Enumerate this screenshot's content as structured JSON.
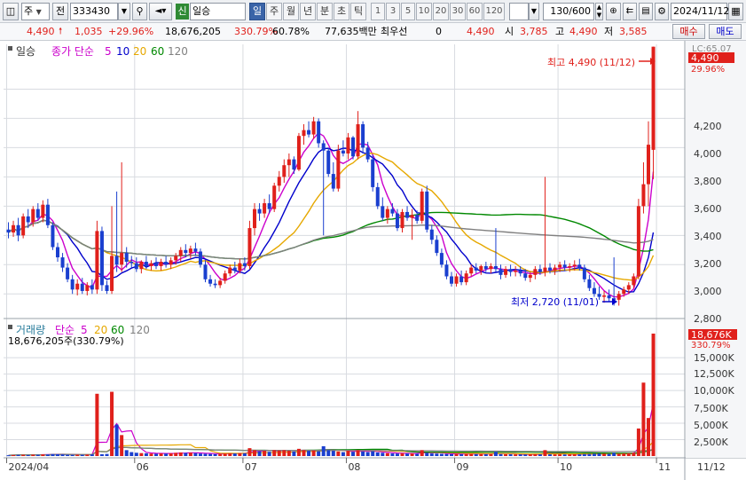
{
  "toolbar": {
    "market": "주",
    "prev_label": "전",
    "code": "333430",
    "credit_tag": "신",
    "stock_name": "일승",
    "periods": [
      "일",
      "주",
      "월",
      "년",
      "분",
      "초",
      "틱"
    ],
    "active_period": "일",
    "minute_units": [
      "1",
      "3",
      "5",
      "10",
      "20",
      "30",
      "60",
      "120"
    ],
    "count": "130/600",
    "date": "2024/11/12"
  },
  "quote": {
    "price": "4,490",
    "change": "1,035",
    "change_pct": "+29.96%",
    "volume": "18,676,205",
    "volume_ratio": "330.79%",
    "turnover": "60.78%",
    "amount": "77,635백만",
    "best_bid_label": "최우선",
    "best_bid": "0",
    "best_ask": "4,490",
    "open_label": "시",
    "open": "3,785",
    "high_label": "고",
    "high": "4,490",
    "low_label": "저",
    "low": "3,585",
    "buy_label": "매수",
    "sell_label": "매도"
  },
  "price_pane": {
    "legend_period": "일승",
    "legend_label": "종가 단순",
    "ma_periods": [
      "5",
      "10",
      "20",
      "60",
      "120"
    ],
    "ma_colors": [
      "#cc00cc",
      "#0000cc",
      "#e6a800",
      "#008800",
      "#808080"
    ],
    "axis_ticks": [
      "4,200",
      "4,000",
      "3,800",
      "3,600",
      "3,400",
      "3,200",
      "3,000",
      "2,800"
    ],
    "price_tag": "4,490",
    "price_tag_pct": "29.96%",
    "lc_label": "LC:65.07",
    "high_annotation": "최고 4,490 (11/12)",
    "low_annotation": "최저 2,720 (11/01)"
  },
  "volume_pane": {
    "legend_label": "거래량",
    "legend_ma": "단순",
    "ma_periods": [
      "5",
      "20",
      "60",
      "120"
    ],
    "info": "18,676,205주(330.79%)",
    "axis_ticks": [
      "15,000K",
      "12,500K",
      "10,000K",
      "7,500K",
      "5,000K",
      "2,500K"
    ],
    "volume_tag": "18,676K",
    "volume_tag_pct": "330.79%"
  },
  "x_axis": {
    "labels": [
      "2024/04",
      "06",
      "07",
      "08",
      "09",
      "10",
      "11"
    ],
    "current": "11/12"
  },
  "colors": {
    "up": "#e0201b",
    "down": "#1a3fcf",
    "grid": "#d8dbe0",
    "accent": "#3a64a8"
  },
  "chart_data": {
    "type": "candlestick",
    "y_range": [
      2650,
      4500
    ],
    "volume_range": [
      0,
      18676
    ],
    "months": [
      [
        "2024/04",
        0
      ],
      [
        "06",
        26
      ],
      [
        "07",
        48
      ],
      [
        "08",
        69
      ],
      [
        "09",
        91
      ],
      [
        "10",
        112
      ],
      [
        "11",
        132
      ]
    ],
    "candles": [
      {
        "o": 3240,
        "h": 3290,
        "l": 3180,
        "c": 3220
      },
      {
        "o": 3220,
        "h": 3300,
        "l": 3190,
        "c": 3270
      },
      {
        "o": 3270,
        "h": 3320,
        "l": 3160,
        "c": 3200
      },
      {
        "o": 3200,
        "h": 3350,
        "l": 3180,
        "c": 3330
      },
      {
        "o": 3330,
        "h": 3380,
        "l": 3250,
        "c": 3290
      },
      {
        "o": 3290,
        "h": 3400,
        "l": 3260,
        "c": 3380
      },
      {
        "o": 3380,
        "h": 3420,
        "l": 3300,
        "c": 3320
      },
      {
        "o": 3320,
        "h": 3440,
        "l": 3290,
        "c": 3410
      },
      {
        "o": 3410,
        "h": 3450,
        "l": 3250,
        "c": 3270
      },
      {
        "o": 3270,
        "h": 3290,
        "l": 3100,
        "c": 3120
      },
      {
        "o": 3120,
        "h": 3150,
        "l": 3020,
        "c": 3050
      },
      {
        "o": 3050,
        "h": 3080,
        "l": 2950,
        "c": 2980
      },
      {
        "o": 2980,
        "h": 3010,
        "l": 2880,
        "c": 2900
      },
      {
        "o": 2900,
        "h": 2930,
        "l": 2800,
        "c": 2830
      },
      {
        "o": 2830,
        "h": 2900,
        "l": 2790,
        "c": 2870
      },
      {
        "o": 2870,
        "h": 2910,
        "l": 2800,
        "c": 2820
      },
      {
        "o": 2820,
        "h": 2880,
        "l": 2790,
        "c": 2860
      },
      {
        "o": 2860,
        "h": 2900,
        "l": 2800,
        "c": 2830
      },
      {
        "o": 2830,
        "h": 3300,
        "l": 2800,
        "c": 3230
      },
      {
        "o": 3230,
        "h": 3260,
        "l": 2820,
        "c": 2860
      },
      {
        "o": 2860,
        "h": 2890,
        "l": 2800,
        "c": 2820
      },
      {
        "o": 2820,
        "h": 3400,
        "l": 2800,
        "c": 3060
      },
      {
        "o": 3060,
        "h": 3500,
        "l": 2950,
        "c": 3000
      },
      {
        "o": 3000,
        "h": 3700,
        "l": 2950,
        "c": 3080
      },
      {
        "o": 3080,
        "h": 3120,
        "l": 2980,
        "c": 3020
      },
      {
        "o": 3020,
        "h": 3060,
        "l": 2980,
        "c": 3010
      },
      {
        "o": 3010,
        "h": 3050,
        "l": 2950,
        "c": 2970
      },
      {
        "o": 2970,
        "h": 3030,
        "l": 2940,
        "c": 3020
      },
      {
        "o": 3020,
        "h": 3060,
        "l": 2970,
        "c": 2990
      },
      {
        "o": 2990,
        "h": 3030,
        "l": 2960,
        "c": 3010
      },
      {
        "o": 3010,
        "h": 3050,
        "l": 2970,
        "c": 2990
      },
      {
        "o": 2990,
        "h": 3040,
        "l": 2960,
        "c": 3020
      },
      {
        "o": 3020,
        "h": 3060,
        "l": 2980,
        "c": 3000
      },
      {
        "o": 3000,
        "h": 3050,
        "l": 2970,
        "c": 3030
      },
      {
        "o": 3030,
        "h": 3080,
        "l": 3000,
        "c": 3060
      },
      {
        "o": 3060,
        "h": 3120,
        "l": 3020,
        "c": 3100
      },
      {
        "o": 3100,
        "h": 3140,
        "l": 3050,
        "c": 3080
      },
      {
        "o": 3080,
        "h": 3130,
        "l": 3040,
        "c": 3110
      },
      {
        "o": 3110,
        "h": 3150,
        "l": 3060,
        "c": 3090
      },
      {
        "o": 3090,
        "h": 3110,
        "l": 2980,
        "c": 3000
      },
      {
        "o": 3000,
        "h": 3030,
        "l": 2880,
        "c": 2900
      },
      {
        "o": 2900,
        "h": 2930,
        "l": 2850,
        "c": 2870
      },
      {
        "o": 2870,
        "h": 2900,
        "l": 2840,
        "c": 2860
      },
      {
        "o": 2860,
        "h": 2910,
        "l": 2840,
        "c": 2890
      },
      {
        "o": 2890,
        "h": 2960,
        "l": 2870,
        "c": 2940
      },
      {
        "o": 2940,
        "h": 3000,
        "l": 2920,
        "c": 2980
      },
      {
        "o": 2980,
        "h": 3020,
        "l": 2940,
        "c": 2960
      },
      {
        "o": 2960,
        "h": 3040,
        "l": 2940,
        "c": 3010
      },
      {
        "o": 3010,
        "h": 3050,
        "l": 2960,
        "c": 2990
      },
      {
        "o": 2990,
        "h": 3300,
        "l": 2970,
        "c": 3250
      },
      {
        "o": 3250,
        "h": 3420,
        "l": 3200,
        "c": 3380
      },
      {
        "o": 3380,
        "h": 3420,
        "l": 3300,
        "c": 3350
      },
      {
        "o": 3350,
        "h": 3450,
        "l": 3320,
        "c": 3420
      },
      {
        "o": 3420,
        "h": 3480,
        "l": 3350,
        "c": 3380
      },
      {
        "o": 3380,
        "h": 3560,
        "l": 3360,
        "c": 3540
      },
      {
        "o": 3540,
        "h": 3640,
        "l": 3500,
        "c": 3600
      },
      {
        "o": 3600,
        "h": 3720,
        "l": 3560,
        "c": 3680
      },
      {
        "o": 3680,
        "h": 3760,
        "l": 3600,
        "c": 3720
      },
      {
        "o": 3720,
        "h": 3740,
        "l": 3620,
        "c": 3650
      },
      {
        "o": 3650,
        "h": 3900,
        "l": 3640,
        "c": 3880
      },
      {
        "o": 3880,
        "h": 3960,
        "l": 3820,
        "c": 3920
      },
      {
        "o": 3920,
        "h": 3980,
        "l": 3870,
        "c": 3890
      },
      {
        "o": 3890,
        "h": 4010,
        "l": 3860,
        "c": 3980
      },
      {
        "o": 3980,
        "h": 4000,
        "l": 3800,
        "c": 3830
      },
      {
        "o": 3830,
        "h": 3850,
        "l": 3200,
        "c": 3780
      },
      {
        "o": 3780,
        "h": 3800,
        "l": 3600,
        "c": 3620
      },
      {
        "o": 3620,
        "h": 3700,
        "l": 3500,
        "c": 3520
      },
      {
        "o": 3520,
        "h": 3820,
        "l": 3500,
        "c": 3780
      },
      {
        "o": 3780,
        "h": 3850,
        "l": 3740,
        "c": 3760
      },
      {
        "o": 3760,
        "h": 3900,
        "l": 3720,
        "c": 3870
      },
      {
        "o": 3870,
        "h": 3880,
        "l": 3720,
        "c": 3740
      },
      {
        "o": 3740,
        "h": 4050,
        "l": 3720,
        "c": 3960
      },
      {
        "o": 3960,
        "h": 3980,
        "l": 3760,
        "c": 3800
      },
      {
        "o": 3800,
        "h": 3840,
        "l": 3700,
        "c": 3720
      },
      {
        "o": 3720,
        "h": 3750,
        "l": 3500,
        "c": 3530
      },
      {
        "o": 3530,
        "h": 3560,
        "l": 3380,
        "c": 3400
      },
      {
        "o": 3400,
        "h": 3460,
        "l": 3300,
        "c": 3320
      },
      {
        "o": 3320,
        "h": 3400,
        "l": 3280,
        "c": 3380
      },
      {
        "o": 3380,
        "h": 3420,
        "l": 3330,
        "c": 3350
      },
      {
        "o": 3350,
        "h": 3380,
        "l": 3230,
        "c": 3250
      },
      {
        "o": 3250,
        "h": 3380,
        "l": 3220,
        "c": 3360
      },
      {
        "o": 3360,
        "h": 3400,
        "l": 3300,
        "c": 3320
      },
      {
        "o": 3320,
        "h": 3380,
        "l": 3170,
        "c": 3340
      },
      {
        "o": 3340,
        "h": 3370,
        "l": 3280,
        "c": 3300
      },
      {
        "o": 3300,
        "h": 3520,
        "l": 3280,
        "c": 3500
      },
      {
        "o": 3500,
        "h": 3540,
        "l": 3220,
        "c": 3240
      },
      {
        "o": 3240,
        "h": 3270,
        "l": 3140,
        "c": 3170
      },
      {
        "o": 3170,
        "h": 3200,
        "l": 3060,
        "c": 3080
      },
      {
        "o": 3080,
        "h": 3110,
        "l": 2980,
        "c": 3000
      },
      {
        "o": 3000,
        "h": 3030,
        "l": 2900,
        "c": 2920
      },
      {
        "o": 2920,
        "h": 2950,
        "l": 2850,
        "c": 2870
      },
      {
        "o": 2870,
        "h": 2940,
        "l": 2850,
        "c": 2920
      },
      {
        "o": 2920,
        "h": 2960,
        "l": 2860,
        "c": 2880
      },
      {
        "o": 2880,
        "h": 2960,
        "l": 2860,
        "c": 2940
      },
      {
        "o": 2940,
        "h": 3000,
        "l": 2920,
        "c": 2980
      },
      {
        "o": 2980,
        "h": 3010,
        "l": 2940,
        "c": 2960
      },
      {
        "o": 2960,
        "h": 3000,
        "l": 2930,
        "c": 2990
      },
      {
        "o": 2990,
        "h": 3020,
        "l": 2950,
        "c": 2970
      },
      {
        "o": 2970,
        "h": 3010,
        "l": 2940,
        "c": 2990
      },
      {
        "o": 2990,
        "h": 3250,
        "l": 2950,
        "c": 2970
      },
      {
        "o": 2970,
        "h": 3000,
        "l": 2900,
        "c": 2930
      },
      {
        "o": 2930,
        "h": 2990,
        "l": 2910,
        "c": 2970
      },
      {
        "o": 2970,
        "h": 3000,
        "l": 2920,
        "c": 2950
      },
      {
        "o": 2950,
        "h": 2990,
        "l": 2920,
        "c": 2960
      },
      {
        "o": 2960,
        "h": 2990,
        "l": 2920,
        "c": 2940
      },
      {
        "o": 2940,
        "h": 2970,
        "l": 2890,
        "c": 2910
      },
      {
        "o": 2910,
        "h": 2950,
        "l": 2880,
        "c": 2930
      },
      {
        "o": 2930,
        "h": 2990,
        "l": 2900,
        "c": 2970
      },
      {
        "o": 2970,
        "h": 3000,
        "l": 2930,
        "c": 2950
      },
      {
        "o": 2950,
        "h": 3600,
        "l": 2920,
        "c": 2980
      },
      {
        "o": 2980,
        "h": 3010,
        "l": 2940,
        "c": 2960
      },
      {
        "o": 2960,
        "h": 3000,
        "l": 2930,
        "c": 2980
      },
      {
        "o": 2980,
        "h": 3020,
        "l": 2950,
        "c": 3000
      },
      {
        "o": 3000,
        "h": 3030,
        "l": 2960,
        "c": 2980
      },
      {
        "o": 2980,
        "h": 3010,
        "l": 2950,
        "c": 2990
      },
      {
        "o": 2990,
        "h": 3030,
        "l": 2960,
        "c": 3000
      },
      {
        "o": 3000,
        "h": 3040,
        "l": 2960,
        "c": 2980
      },
      {
        "o": 2980,
        "h": 3000,
        "l": 2880,
        "c": 2900
      },
      {
        "o": 2900,
        "h": 2930,
        "l": 2820,
        "c": 2840
      },
      {
        "o": 2840,
        "h": 2880,
        "l": 2780,
        "c": 2800
      },
      {
        "o": 2800,
        "h": 2850,
        "l": 2760,
        "c": 2780
      },
      {
        "o": 2780,
        "h": 2820,
        "l": 2740,
        "c": 2790
      },
      {
        "o": 2790,
        "h": 2830,
        "l": 2750,
        "c": 2770
      },
      {
        "o": 2770,
        "h": 3050,
        "l": 2720,
        "c": 2760
      },
      {
        "o": 2760,
        "h": 2820,
        "l": 2720,
        "c": 2800
      },
      {
        "o": 2800,
        "h": 2850,
        "l": 2780,
        "c": 2830
      },
      {
        "o": 2830,
        "h": 2880,
        "l": 2800,
        "c": 2860
      },
      {
        "o": 2860,
        "h": 2940,
        "l": 2840,
        "c": 2920
      },
      {
        "o": 2920,
        "h": 3450,
        "l": 2900,
        "c": 3400
      },
      {
        "o": 3400,
        "h": 3700,
        "l": 3350,
        "c": 3550
      },
      {
        "o": 3550,
        "h": 3980,
        "l": 3400,
        "c": 3820
      },
      {
        "o": 3785,
        "h": 4490,
        "l": 3585,
        "c": 4490
      }
    ],
    "volume": [
      120,
      150,
      180,
      200,
      160,
      220,
      190,
      260,
      230,
      300,
      280,
      250,
      200,
      180,
      210,
      190,
      230,
      260,
      9500,
      280,
      320,
      9800,
      4800,
      3200,
      900,
      600,
      500,
      450,
      420,
      380,
      350,
      400,
      380,
      420,
      500,
      550,
      480,
      520,
      450,
      380,
      350,
      320,
      300,
      320,
      380,
      420,
      400,
      450,
      420,
      1200,
      900,
      700,
      800,
      650,
      900,
      850,
      900,
      800,
      700,
      1100,
      900,
      800,
      850,
      750,
      1500,
      900,
      800,
      700,
      600,
      800,
      650,
      900,
      700,
      600,
      750,
      550,
      500,
      450,
      400,
      380,
      420,
      380,
      400,
      350,
      900,
      500,
      400,
      380,
      350,
      320,
      300,
      310,
      290,
      320,
      350,
      300,
      310,
      290,
      300,
      650,
      300,
      280,
      270,
      260,
      250,
      240,
      260,
      280,
      260,
      900,
      270,
      260,
      280,
      250,
      260,
      270,
      280,
      300,
      320,
      350,
      380,
      360,
      340,
      500,
      360,
      400,
      420,
      500,
      4200,
      11200,
      5800,
      18676
    ]
  }
}
